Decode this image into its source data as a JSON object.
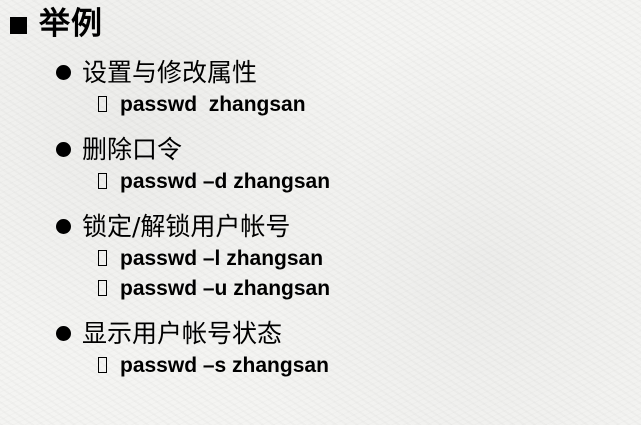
{
  "slide": {
    "title": "举例",
    "items": [
      {
        "label": "设置与修改属性",
        "commands": [
          "passwd  zhangsan"
        ]
      },
      {
        "label": "删除口令",
        "commands": [
          "passwd –d zhangsan"
        ]
      },
      {
        "label": "锁定/解锁用户帐号",
        "commands": [
          "passwd –l zhangsan",
          "passwd –u zhangsan"
        ]
      },
      {
        "label": "显示用户帐号状态",
        "commands": [
          "passwd –s zhangsan"
        ]
      }
    ]
  }
}
